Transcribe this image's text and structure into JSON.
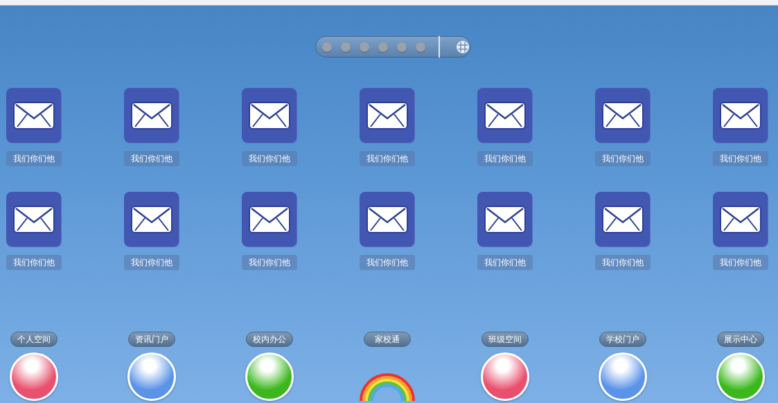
{
  "pager": {
    "pages": [
      {
        "selected": false
      },
      {
        "selected": false
      },
      {
        "selected": false
      },
      {
        "selected": false
      },
      {
        "selected": false
      },
      {
        "selected": false
      }
    ]
  },
  "apps": [
    {
      "label": "我们你们他"
    },
    {
      "label": "我们你们他"
    },
    {
      "label": "我们你们他"
    },
    {
      "label": "我们你们他"
    },
    {
      "label": "我们你们他"
    },
    {
      "label": "我们你们他"
    },
    {
      "label": "我们你们他"
    },
    {
      "label": "我们你们他"
    },
    {
      "label": "我们你们他"
    },
    {
      "label": "我们你们他"
    },
    {
      "label": "我们你们他"
    },
    {
      "label": "我们你们他"
    },
    {
      "label": "我们你们他"
    },
    {
      "label": "我们你们他"
    }
  ],
  "dock": [
    {
      "label": "个人空间",
      "kind": "ball",
      "color": "#e8506e"
    },
    {
      "label": "资讯门户",
      "kind": "ball",
      "color": "#5b93e8"
    },
    {
      "label": "校内办公",
      "kind": "ball",
      "color": "#3cb81e"
    },
    {
      "label": "家校通",
      "kind": "rainbow"
    },
    {
      "label": "班级空间",
      "kind": "ball",
      "color": "#e8506e"
    },
    {
      "label": "学校门户",
      "kind": "ball",
      "color": "#5b93e8"
    },
    {
      "label": "展示中心",
      "kind": "ball",
      "color": "#3cb81e"
    }
  ]
}
